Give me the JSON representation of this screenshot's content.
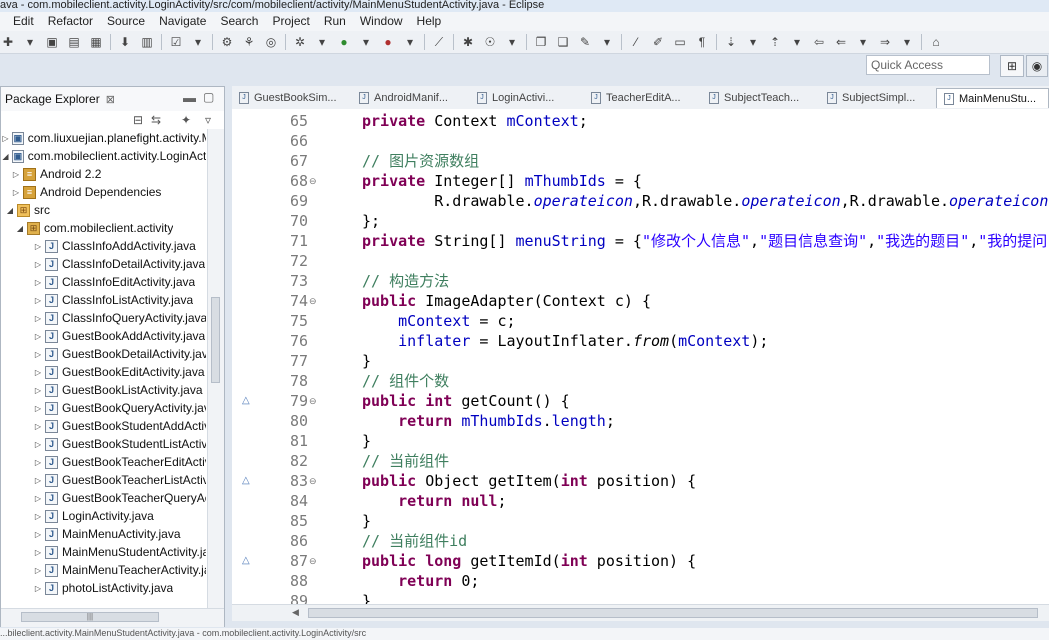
{
  "window": {
    "title": "ava - com.mobileclient.activity.LoginActivity/src/com/mobileclient/activity/MainMenuStudentActivity.java - Eclipse"
  },
  "menubar": {
    "items": [
      "Edit",
      "Refactor",
      "Source",
      "Navigate",
      "Search",
      "Project",
      "Run",
      "Window",
      "Help"
    ]
  },
  "quick_access": {
    "placeholder": "Quick Access"
  },
  "package_explorer": {
    "tab_label": "Package Explorer",
    "close_glyph": "⊠",
    "items": [
      {
        "label": "com.liuxuejian.planefight.activity.Main",
        "icon": "project-icon",
        "expanded": false
      },
      {
        "label": "com.mobileclient.activity.LoginActivity",
        "icon": "project-icon",
        "expanded": true
      },
      {
        "label": "Android 2.2",
        "icon": "library-icon",
        "expanded": false
      },
      {
        "label": "Android Dependencies",
        "icon": "library-icon",
        "expanded": false
      },
      {
        "label": "src",
        "icon": "source-folder-icon",
        "expanded": true
      },
      {
        "label": "com.mobileclient.activity",
        "icon": "package-icon",
        "expanded": true
      },
      {
        "label": "ClassInfoAddActivity.java",
        "icon": "java-file-icon",
        "expanded": false
      },
      {
        "label": "ClassInfoDetailActivity.java",
        "icon": "java-file-icon",
        "expanded": false
      },
      {
        "label": "ClassInfoEditActivity.java",
        "icon": "java-file-icon",
        "expanded": false
      },
      {
        "label": "ClassInfoListActivity.java",
        "icon": "java-file-icon",
        "expanded": false
      },
      {
        "label": "ClassInfoQueryActivity.java",
        "icon": "java-file-icon",
        "expanded": false
      },
      {
        "label": "GuestBookAddActivity.java",
        "icon": "java-file-icon",
        "expanded": false
      },
      {
        "label": "GuestBookDetailActivity.java",
        "icon": "java-file-icon",
        "expanded": false
      },
      {
        "label": "GuestBookEditActivity.java",
        "icon": "java-file-icon",
        "expanded": false
      },
      {
        "label": "GuestBookListActivity.java",
        "icon": "java-file-icon",
        "expanded": false
      },
      {
        "label": "GuestBookQueryActivity.jav",
        "icon": "java-file-icon",
        "expanded": false
      },
      {
        "label": "GuestBookStudentAddActiv",
        "icon": "java-file-icon",
        "expanded": false
      },
      {
        "label": "GuestBookStudentListActivi",
        "icon": "java-file-icon",
        "expanded": false
      },
      {
        "label": "GuestBookTeacherEditActiv",
        "icon": "java-file-icon",
        "expanded": false
      },
      {
        "label": "GuestBookTeacherListActivi",
        "icon": "java-file-icon",
        "expanded": false
      },
      {
        "label": "GuestBookTeacherQueryAc",
        "icon": "java-file-icon",
        "expanded": false
      },
      {
        "label": "LoginActivity.java",
        "icon": "java-file-icon",
        "expanded": false
      },
      {
        "label": "MainMenuActivity.java",
        "icon": "java-file-icon",
        "expanded": false
      },
      {
        "label": "MainMenuStudentActivity.ja",
        "icon": "java-file-icon",
        "expanded": false
      },
      {
        "label": "MainMenuTeacherActivity.ja",
        "icon": "java-file-icon",
        "expanded": false
      },
      {
        "label": "photoListActivity.java",
        "icon": "java-file-icon",
        "expanded": false
      }
    ]
  },
  "editor_tabs": [
    {
      "label": "GuestBookSim...",
      "active": false
    },
    {
      "label": "AndroidManif...",
      "active": false
    },
    {
      "label": "LoginActivi...",
      "active": false
    },
    {
      "label": "TeacherEditA...",
      "active": false
    },
    {
      "label": "SubjectTeach...",
      "active": false
    },
    {
      "label": "SubjectSimpl...",
      "active": false
    },
    {
      "label": "MainMenuStu...",
      "active": true
    }
  ],
  "code": {
    "line_numbers": [
      "65",
      "66",
      "67",
      "68",
      "69",
      "70",
      "71",
      "72",
      "73",
      "74",
      "75",
      "76",
      "77",
      "78",
      "79",
      "80",
      "81",
      "82",
      "83",
      "84",
      "85",
      "86",
      "87",
      "88",
      "89"
    ],
    "fold_lines": [
      "68",
      "74",
      "79",
      "83",
      "87"
    ],
    "override_lines": [
      "79",
      "83",
      "87"
    ],
    "text": {
      "l65": "private",
      "l65b": " Context ",
      "l65c": "mContext",
      "l65d": ";",
      "l67": "// 图片资源数组",
      "l68a": "private",
      "l68b": " Integer[] ",
      "l68c": "mThumbIds",
      "l68d": " = {",
      "l69a": "        R.drawable.",
      "l69b": "operateicon",
      "l69c": ",R.drawable.",
      "l69d": "operateicon",
      "l69e": ",R.drawable.",
      "l69f": "operateicon",
      "l69g": ",",
      "l70": "};",
      "l71a": "private",
      "l71b": " String[] ",
      "l71c": "menuString",
      "l71d": " = {",
      "l71e": "\"修改个人信息\"",
      "l71f": ",",
      "l71g": "\"题目信息查询\"",
      "l71h": ",",
      "l71i": "\"我选的题目\"",
      "l71j": ",",
      "l71k": "\"我的提问\"",
      "l71l": "};",
      "l73": "// 构造方法",
      "l74a": "public",
      "l74b": " ImageAdapter(Context c) {",
      "l75a": "    ",
      "l75b": "mContext",
      "l75c": " = c;",
      "l76a": "    ",
      "l76b": "inflater",
      "l76c": " = LayoutInflater.",
      "l76d": "from",
      "l76e": "(",
      "l76f": "mContext",
      "l76g": ");",
      "l77": "}",
      "l78": "// 组件个数",
      "l79a": "public",
      "l79b": " ",
      "l79c": "int",
      "l79d": " getCount() {",
      "l80a": "    ",
      "l80b": "return",
      "l80c": " ",
      "l80d": "mThumbIds",
      "l80e": ".",
      "l80f": "length",
      "l80g": ";",
      "l81": "}",
      "l82": "// 当前组件",
      "l83a": "public",
      "l83b": " Object getItem(",
      "l83c": "int",
      "l83d": " position) {",
      "l84a": "    ",
      "l84b": "return",
      "l84c": " ",
      "l84d": "null",
      "l84e": ";",
      "l85": "}",
      "l86": "// 当前组件id",
      "l87a": "public",
      "l87b": " ",
      "l87c": "long",
      "l87d": " getItemId(",
      "l87e": "int",
      "l87f": " position) {",
      "l88a": "    ",
      "l88b": "return",
      "l88c": " 0;",
      "l89": "}"
    }
  },
  "statusbar": {
    "text": "...bileclient.activity.MainMenuStudentActivity.java - com.mobileclient.activity.LoginActivity/src"
  }
}
